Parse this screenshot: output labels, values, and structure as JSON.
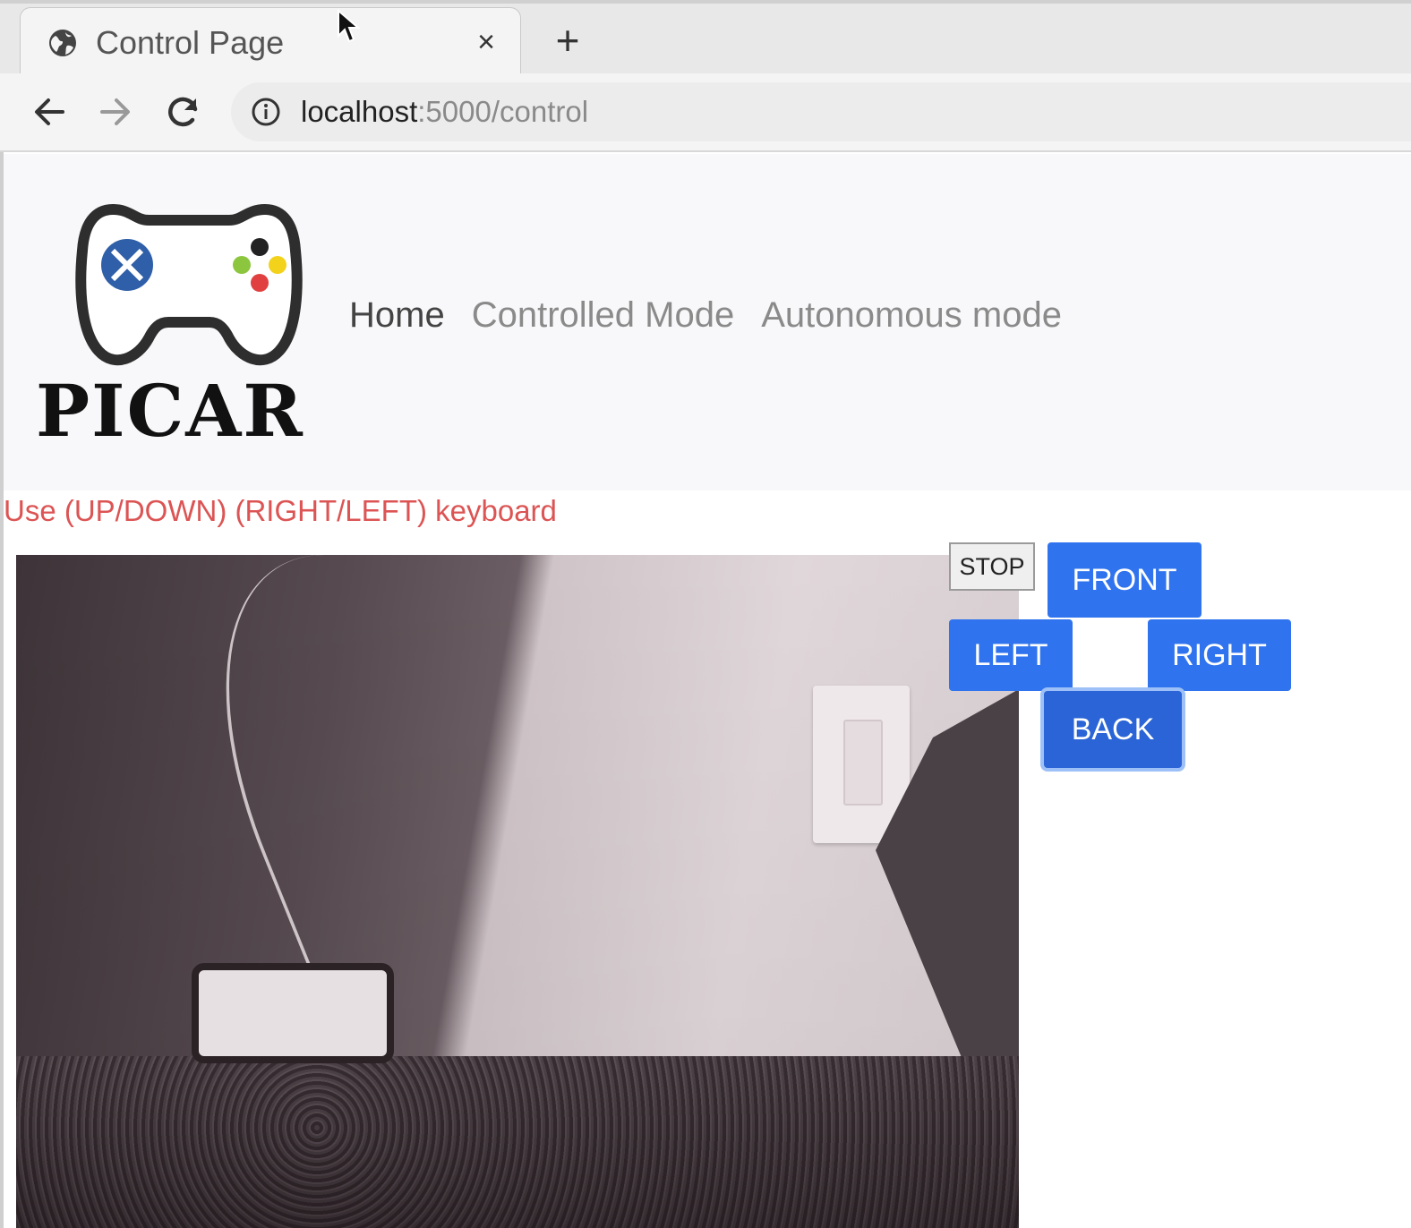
{
  "browser": {
    "tab_title": "Control Page",
    "tab_close": "×",
    "new_tab": "+",
    "url_host": "localhost",
    "url_rest": ":5000/control"
  },
  "nav": {
    "logo_text": "PICAR",
    "links": [
      {
        "label": "Home",
        "active": true
      },
      {
        "label": "Controlled Mode",
        "active": false
      },
      {
        "label": "Autonomous mode",
        "active": false
      }
    ]
  },
  "page": {
    "hint": "Use (UP/DOWN) (RIGHT/LEFT) keyboard"
  },
  "controls": {
    "stop": "STOP",
    "front": "FRONT",
    "left": "LEFT",
    "right": "RIGHT",
    "back": "BACK"
  },
  "colors": {
    "button_blue": "#2f73ee",
    "hint_red": "#dc5454",
    "logo_x_blue": "#2f5fa8"
  },
  "icons": [
    "globe-icon",
    "close-icon",
    "plus-icon",
    "back-arrow-icon",
    "forward-arrow-icon",
    "reload-icon",
    "info-icon",
    "gamepad-logo-icon",
    "mouse-cursor-icon"
  ]
}
